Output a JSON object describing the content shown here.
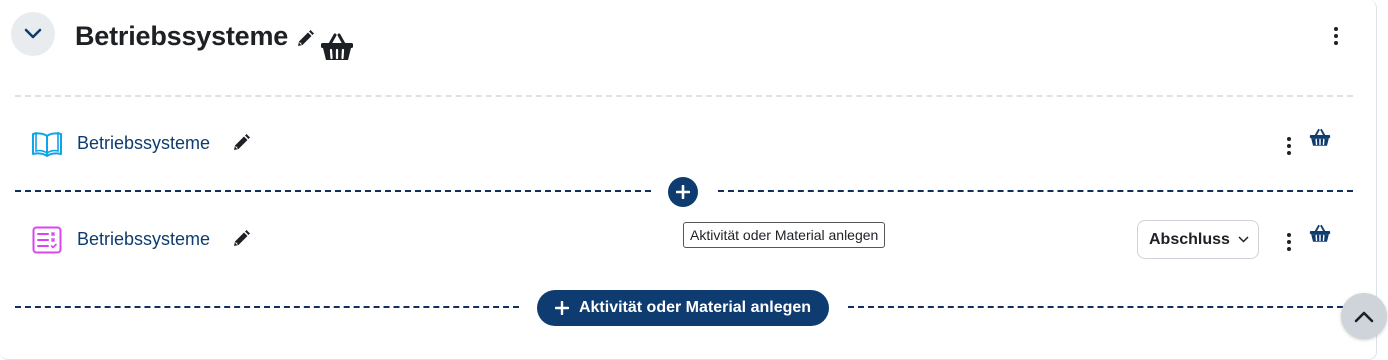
{
  "section": {
    "title": "Betriebssysteme",
    "collapse_icon": "chevron-down-icon",
    "menu_icon": "kebab-icon"
  },
  "activities": [
    {
      "name": "Betriebssysteme",
      "icon": "book-icon",
      "icon_color": "#0ea5e9"
    },
    {
      "name": "Betriebssysteme",
      "icon": "checklist-icon",
      "icon_color": "#d946ef",
      "completion_label": "Abschluss"
    }
  ],
  "add_tooltip": "Aktivität oder Material anlegen",
  "add_button_label": "Aktivität oder Material anlegen",
  "colors": {
    "accent": "#0f3c70",
    "separator": "#0f2f5e",
    "light_separator": "#dee2e6"
  }
}
